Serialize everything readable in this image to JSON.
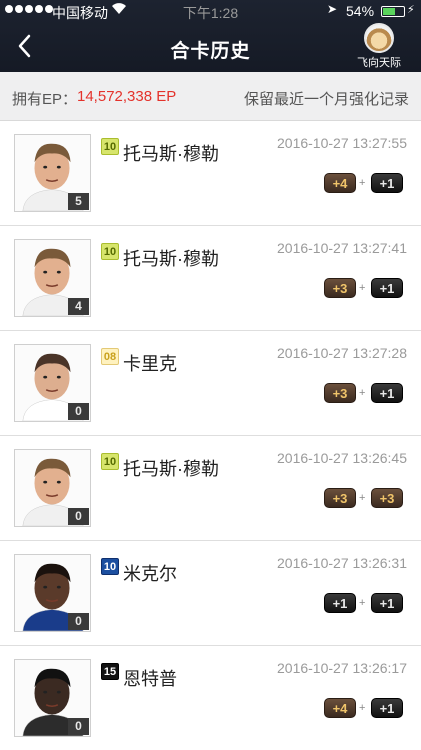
{
  "status_bar": {
    "carrier": "中国移动",
    "time": "下午1:28",
    "battery_pct": "54%",
    "battery_level": 0.54
  },
  "nav": {
    "title": "合卡历史",
    "user_name": "飞向天际"
  },
  "ep": {
    "label": "拥有EP：",
    "value": "14,572,338 EP",
    "note": "保留最近一个月强化记录"
  },
  "records": [
    {
      "level": "5",
      "season": "10",
      "name": "托马斯·穆勒",
      "time": "2016-10-27 13:27:55",
      "chip1": "+4",
      "chip2": "+1",
      "sign": "+"
    },
    {
      "level": "4",
      "season": "10",
      "name": "托马斯·穆勒",
      "time": "2016-10-27 13:27:41",
      "chip1": "+3",
      "chip2": "+1",
      "sign": "+"
    },
    {
      "level": "0",
      "season": "08",
      "name": "卡里克",
      "time": "2016-10-27 13:27:28",
      "chip1": "+3",
      "chip2": "+1",
      "sign": "+"
    },
    {
      "level": "0",
      "season": "10",
      "name": "托马斯·穆勒",
      "time": "2016-10-27 13:26:45",
      "chip1": "+3",
      "chip2": "+3",
      "sign": "+"
    },
    {
      "level": "0",
      "season": "10",
      "name": "米克尔",
      "time": "2016-10-27 13:26:31",
      "chip1": "+1",
      "chip2": "+1",
      "sign": "+"
    },
    {
      "level": "0",
      "season": "15",
      "name": "恩特普",
      "time": "2016-10-27 13:26:17",
      "chip1": "+4",
      "chip2": "+1",
      "sign": "+"
    }
  ],
  "colors": {
    "nav_bg": "#1d2330",
    "ep_value": "#e4322b",
    "timestamp": "#9a9a9a"
  }
}
